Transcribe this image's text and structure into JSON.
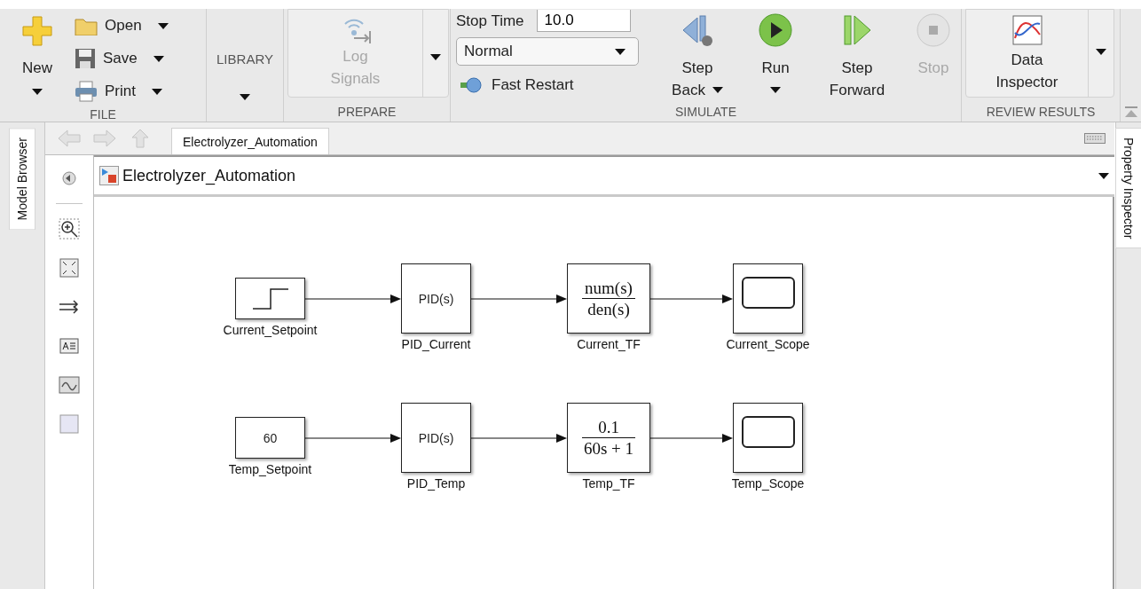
{
  "ribbon": {
    "sections": [
      {
        "kind": "file",
        "title": "FILE",
        "new_button": {
          "label": "New",
          "menu": true
        },
        "items": [
          {
            "label": "Open",
            "menu": true
          },
          {
            "label": "Save",
            "menu": true
          },
          {
            "label": "Print",
            "menu": true
          }
        ]
      },
      {
        "kind": "library",
        "button": {
          "label": "LIBRARY",
          "menu": true
        }
      },
      {
        "kind": "prepare",
        "title": "PREPARE",
        "button": {
          "label": "Log\nSignals",
          "disabled": true,
          "menu": true
        }
      },
      {
        "kind": "simulate",
        "title": "SIMULATE",
        "stop_time": {
          "label": "Stop Time",
          "value": "10.0"
        },
        "mode": {
          "value": "Normal"
        },
        "fast_restart": {
          "label": "Fast Restart"
        },
        "buttons": [
          {
            "kind": "step_back",
            "label": "Step\nBack",
            "menu": true,
            "disabled": false
          },
          {
            "kind": "run",
            "label": "Run",
            "menu": true,
            "disabled": false
          },
          {
            "kind": "step_forward",
            "label": "Step\nForward",
            "menu": false,
            "disabled": false
          },
          {
            "kind": "stop",
            "label": "Stop",
            "menu": false,
            "disabled": true
          }
        ]
      },
      {
        "kind": "review",
        "title": "REVIEW RESULTS",
        "button": {
          "label": "Data\nInspector",
          "menu": true
        }
      }
    ]
  },
  "side_tabs": {
    "left": "Model Browser",
    "right": "Property Inspector"
  },
  "editor": {
    "tab": {
      "label": "Electrolyzer_Automation",
      "selected": true
    },
    "breadcrumb": "Electrolyzer_Automation",
    "diagram": {
      "rows": [
        {
          "blocks": [
            {
              "kind": "step",
              "name": "Current_Setpoint"
            },
            {
              "kind": "pid",
              "text": "PID(s)",
              "name": "PID_Current"
            },
            {
              "kind": "tf",
              "numerator": "num(s)",
              "denominator": "den(s)",
              "name": "Current_TF"
            },
            {
              "kind": "scope",
              "name": "Current_Scope"
            }
          ]
        },
        {
          "blocks": [
            {
              "kind": "constant",
              "text": "60",
              "name": "Temp_Setpoint"
            },
            {
              "kind": "pid",
              "text": "PID(s)",
              "name": "PID_Temp"
            },
            {
              "kind": "tf",
              "numerator": "0.1",
              "denominator": "60s + 1",
              "name": "Temp_TF"
            },
            {
              "kind": "scope",
              "name": "Temp_Scope"
            }
          ]
        }
      ]
    }
  }
}
